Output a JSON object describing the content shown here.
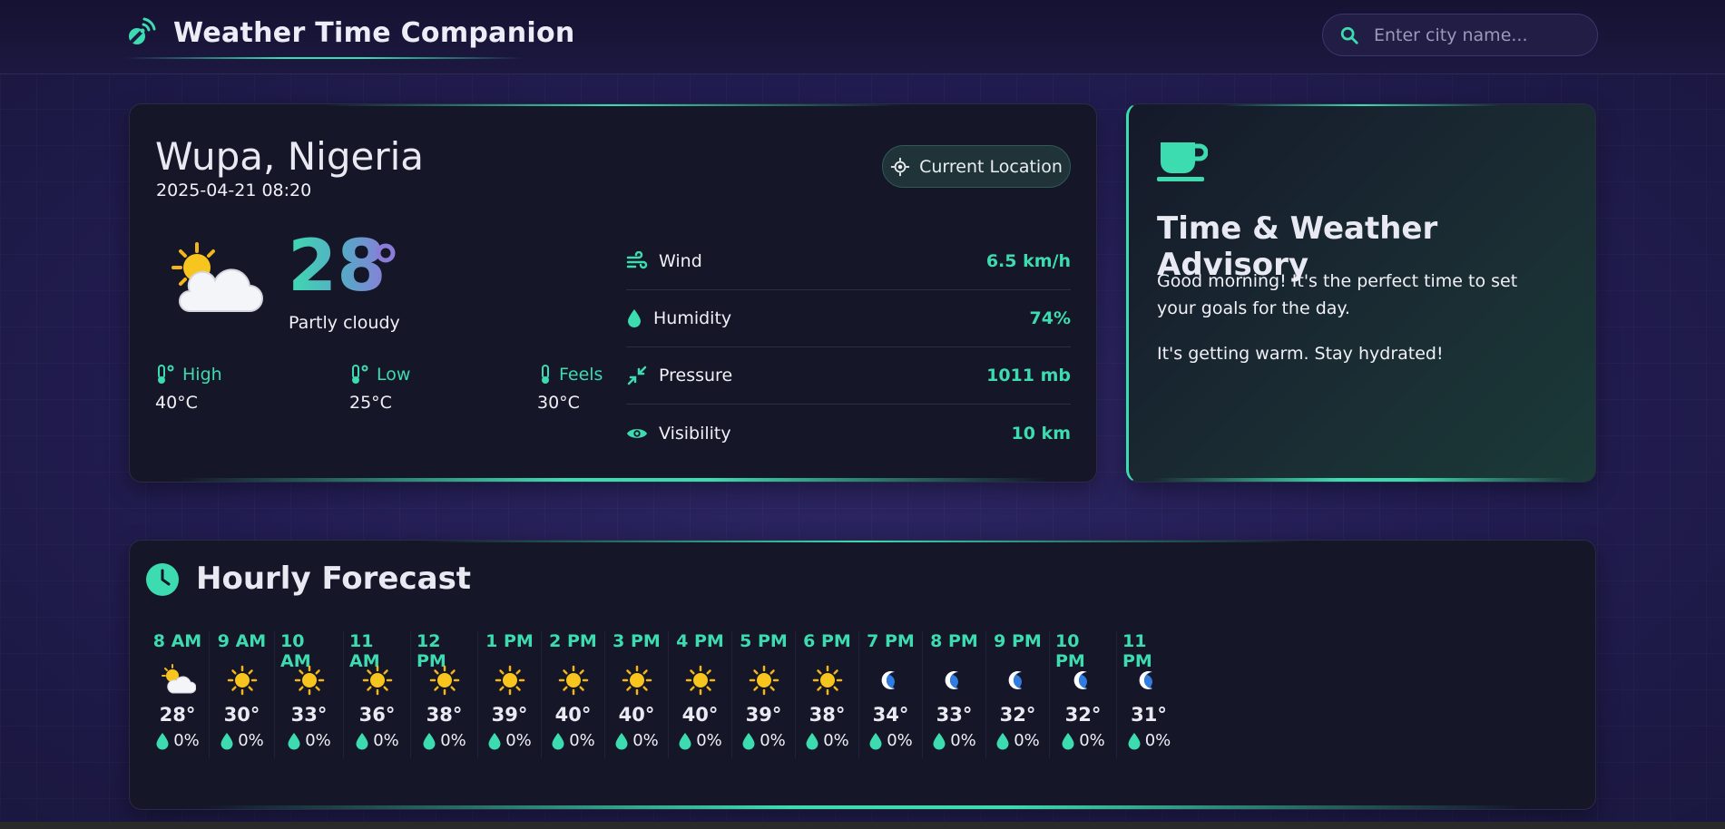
{
  "header": {
    "title": "Weather Time Companion",
    "search_placeholder": "Enter city name..."
  },
  "current": {
    "location": "Wupa, Nigeria",
    "datetime": "2025-04-21 08:20",
    "location_button": "Current Location",
    "temperature": "28",
    "condition": "Partly cloudy",
    "condition_icon": "partly-cloudy-icon",
    "high_label": "High",
    "high_value": "40°C",
    "low_label": "Low",
    "low_value": "25°C",
    "feels_label": "Feels",
    "feels_value": "30°C"
  },
  "details": [
    {
      "label": "Wind",
      "value": "6.5 km/h",
      "icon": "wind-icon"
    },
    {
      "label": "Humidity",
      "value": "74%",
      "icon": "droplet-icon"
    },
    {
      "label": "Pressure",
      "value": "1011 mb",
      "icon": "compress-icon"
    },
    {
      "label": "Visibility",
      "value": "10 km",
      "icon": "eye-icon"
    }
  ],
  "advisory": {
    "title": "Time & Weather Advisory",
    "icon": "coffee-cup-icon",
    "messages": [
      "Good morning! It's the perfect time to set your goals for the day.",
      "It's getting warm. Stay hydrated!"
    ]
  },
  "hourly": {
    "title": "Hourly Forecast",
    "items": [
      {
        "time": "8 AM",
        "icon": "partly-cloudy",
        "temp": "28°",
        "precip": "0%"
      },
      {
        "time": "9 AM",
        "icon": "sun",
        "temp": "30°",
        "precip": "0%"
      },
      {
        "time": "10 AM",
        "icon": "sun",
        "temp": "33°",
        "precip": "0%"
      },
      {
        "time": "11 AM",
        "icon": "sun",
        "temp": "36°",
        "precip": "0%"
      },
      {
        "time": "12 PM",
        "icon": "sun",
        "temp": "38°",
        "precip": "0%"
      },
      {
        "time": "1 PM",
        "icon": "sun",
        "temp": "39°",
        "precip": "0%"
      },
      {
        "time": "2 PM",
        "icon": "sun",
        "temp": "40°",
        "precip": "0%"
      },
      {
        "time": "3 PM",
        "icon": "sun",
        "temp": "40°",
        "precip": "0%"
      },
      {
        "time": "4 PM",
        "icon": "sun",
        "temp": "40°",
        "precip": "0%"
      },
      {
        "time": "5 PM",
        "icon": "sun",
        "temp": "39°",
        "precip": "0%"
      },
      {
        "time": "6 PM",
        "icon": "sun",
        "temp": "38°",
        "precip": "0%"
      },
      {
        "time": "7 PM",
        "icon": "moon",
        "temp": "34°",
        "precip": "0%"
      },
      {
        "time": "8 PM",
        "icon": "moon",
        "temp": "33°",
        "precip": "0%"
      },
      {
        "time": "9 PM",
        "icon": "moon",
        "temp": "32°",
        "precip": "0%"
      },
      {
        "time": "10 PM",
        "icon": "moon",
        "temp": "32°",
        "precip": "0%"
      },
      {
        "time": "11 PM",
        "icon": "moon",
        "temp": "31°",
        "precip": "0%"
      }
    ]
  },
  "colors": {
    "accent": "#3ddbb0",
    "background": "#221d52",
    "card": "#151628"
  }
}
